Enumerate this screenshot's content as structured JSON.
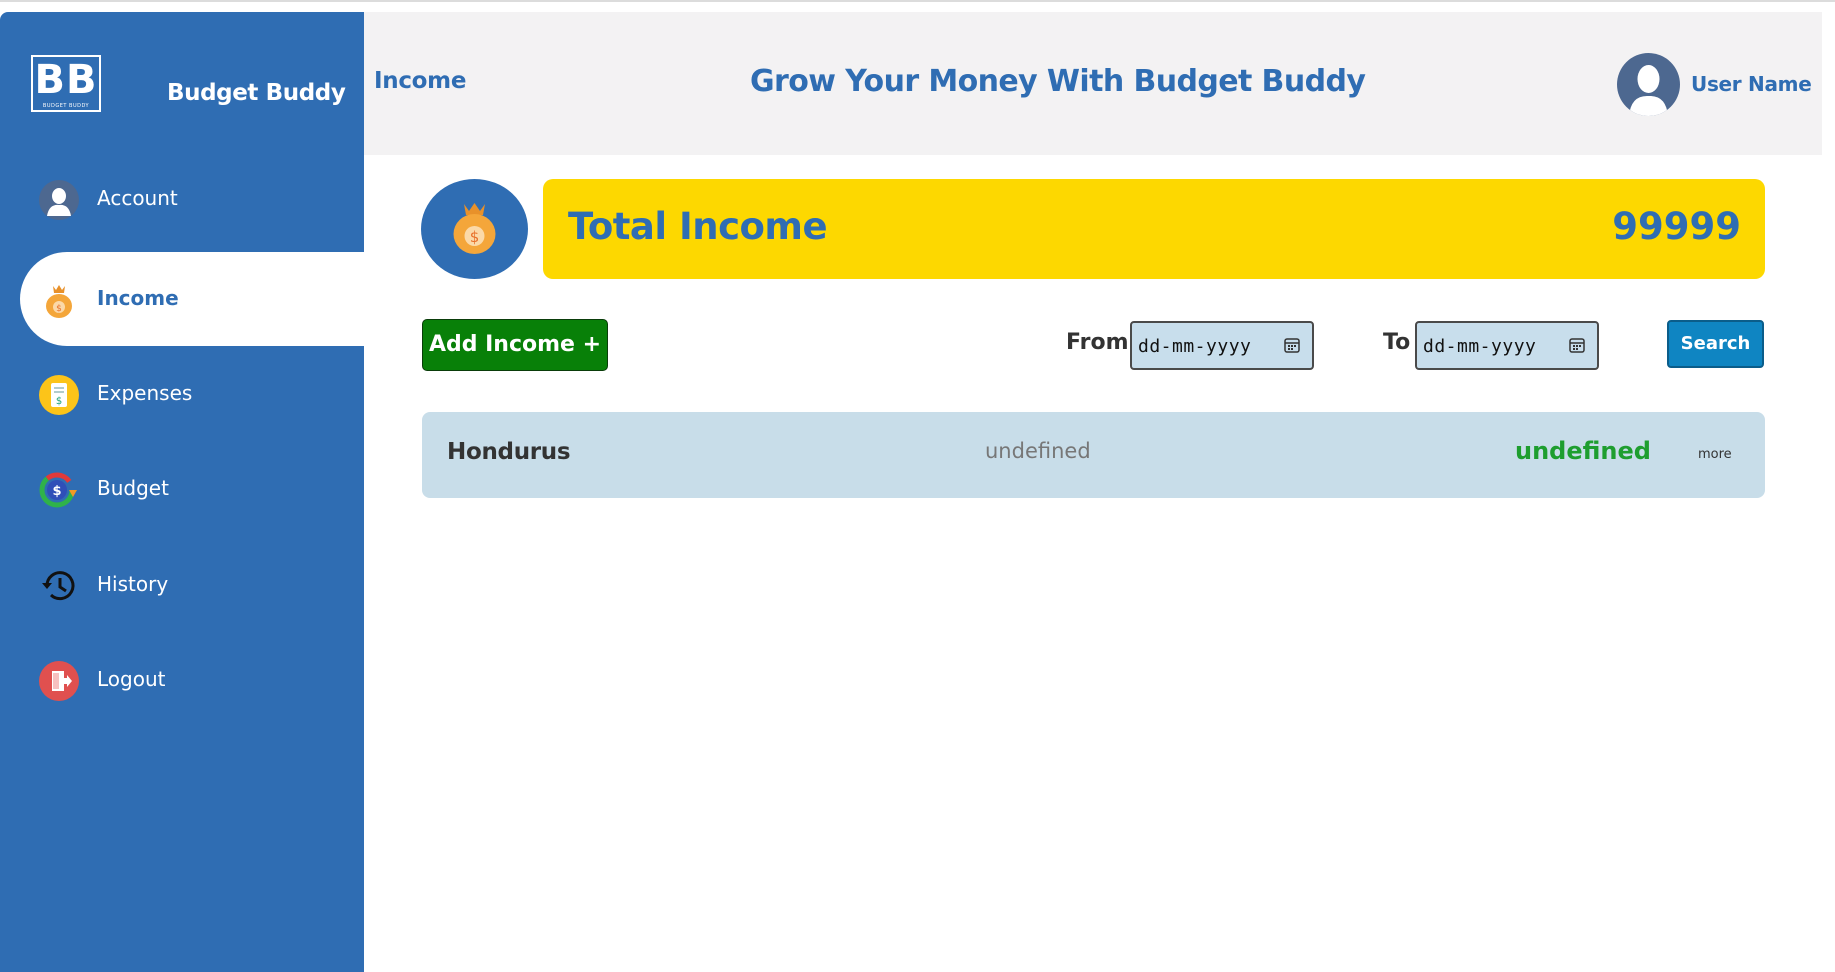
{
  "sidebar": {
    "logo_letters": "BB",
    "logo_sub": "BUDGET BUDDY",
    "brand": "Budget Buddy",
    "items": [
      {
        "label": "Account",
        "icon": "account-avatar-icon"
      },
      {
        "label": "Income",
        "icon": "money-bag-icon",
        "active": true
      },
      {
        "label": "Expenses",
        "icon": "receipt-icon"
      },
      {
        "label": "Budget",
        "icon": "budget-dollar-icon"
      },
      {
        "label": "History",
        "icon": "history-clock-icon"
      },
      {
        "label": "Logout",
        "icon": "logout-door-icon"
      }
    ]
  },
  "header": {
    "page_title": "Income",
    "tagline": "Grow Your Money With Budget Buddy",
    "user_name": "User Name"
  },
  "summary": {
    "label": "Total Income",
    "value": "99999"
  },
  "toolbar": {
    "add_label": "Add Income +",
    "from_label": "From",
    "to_label": "To",
    "from_placeholder": "dd-mm-yyyy",
    "to_placeholder": "dd-mm-yyyy",
    "search_label": "Search"
  },
  "incomes": [
    {
      "name": "Hondurus",
      "date": "undefined",
      "amount": "undefined",
      "more": "more"
    }
  ],
  "colors": {
    "primary": "#2f6db3",
    "highlight": "#fdd800",
    "add_button": "#088008",
    "search_button": "#0f85c2",
    "row_bg": "#c8dde9",
    "amount": "#1e9e2f"
  }
}
